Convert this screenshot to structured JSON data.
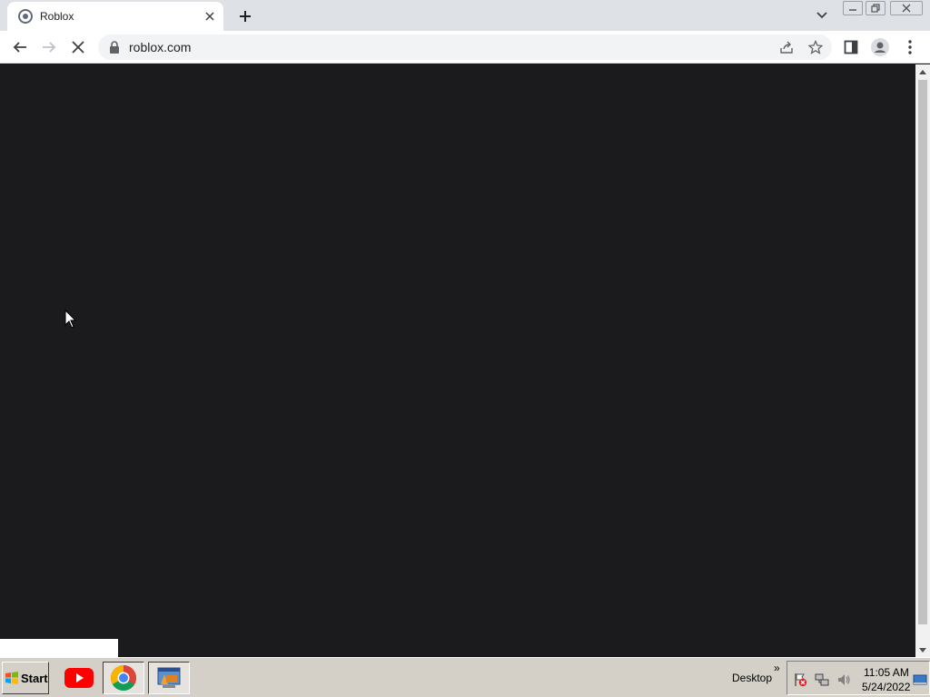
{
  "browser": {
    "tab": {
      "title": "Roblox"
    },
    "address_bar": {
      "url": "roblox.com"
    }
  },
  "taskbar": {
    "start_label": "Start",
    "toolbar_label": "Desktop",
    "clock": {
      "time": "11:05 AM",
      "date": "5/24/2022"
    }
  },
  "icons": {
    "tab_favicon": "roblox-favicon-icon",
    "tab_close": "close-icon",
    "new_tab": "plus-icon",
    "back": "arrow-left-icon",
    "forward": "arrow-right-icon",
    "stop": "close-icon",
    "lock": "lock-icon",
    "share": "share-icon",
    "bookmark": "star-icon",
    "side_panel": "side-panel-icon",
    "profile": "profile-icon",
    "menu": "three-dot-menu-icon"
  },
  "colors": {
    "page_background": "#1b1b1d",
    "tabstrip": "#dee1e6",
    "taskbar": "#d4d0c8",
    "youtube_red": "#ff0000"
  }
}
